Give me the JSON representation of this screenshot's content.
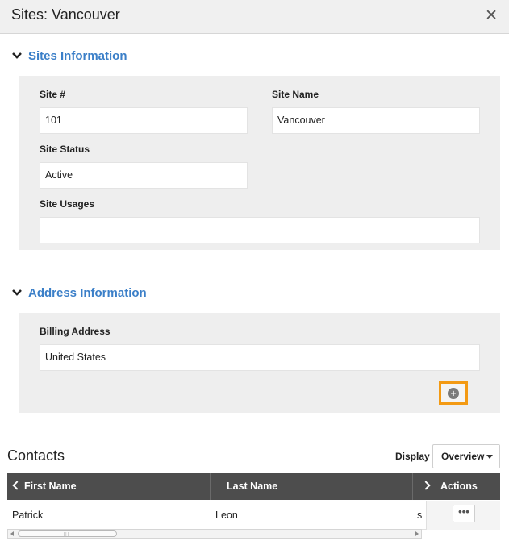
{
  "dialog": {
    "title": "Sites: Vancouver",
    "close_glyph": "✕"
  },
  "sites_info": {
    "heading": "Sites Information",
    "site_number": {
      "label": "Site #",
      "value": "101"
    },
    "site_name": {
      "label": "Site Name",
      "value": "Vancouver"
    },
    "site_status": {
      "label": "Site Status",
      "value": "Active"
    },
    "site_usages": {
      "label": "Site Usages",
      "value": ""
    }
  },
  "address_info": {
    "heading": "Address Information",
    "billing_address": {
      "label": "Billing Address",
      "value": "United States"
    },
    "add_glyph": "+"
  },
  "contacts": {
    "title": "Contacts",
    "display_label": "Display",
    "display_selected": "Overview",
    "columns": {
      "first_name": "First Name",
      "last_name": "Last Name",
      "actions": "Actions"
    },
    "rows": [
      {
        "first_name": "Patrick",
        "last_name": "Leon",
        "truncated": "s",
        "more_glyph": "•••"
      }
    ]
  },
  "icons": {
    "section_toggle": "chevron-down-icon",
    "close": "close-icon",
    "add": "plus-circle-icon",
    "more": "ellipsis-icon"
  },
  "colors": {
    "section_heading": "#3b7fc8",
    "highlight_border": "#f39a14",
    "grid_header": "#4d4d4d"
  }
}
